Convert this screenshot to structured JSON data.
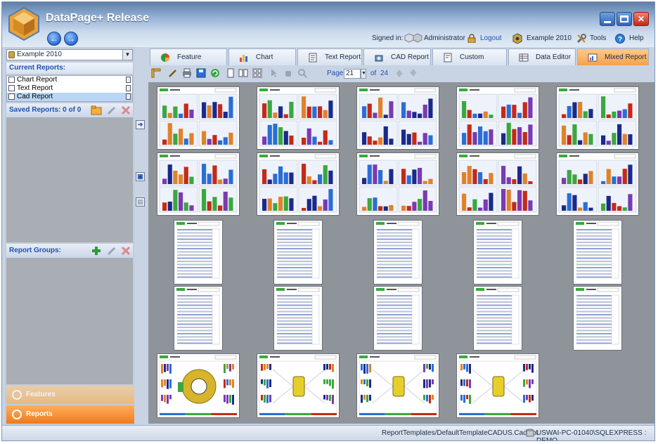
{
  "app": {
    "title": "DataPage+ Release"
  },
  "header": {
    "signed_in_label": "Signed in:",
    "user": "Administrator",
    "logout": "Logout",
    "database": "Example 2010",
    "tools": "Tools",
    "help": "Help"
  },
  "sidebar": {
    "db_select": "Example 2010",
    "current_reports_label": "Current Reports:",
    "reports": [
      "Chart Report",
      "Text Report",
      "Cad Report"
    ],
    "selected_report": "Cad Report",
    "saved_reports_label": "Saved Reports: 0 of 0",
    "report_groups_label": "Report Groups:",
    "features_label": "Features",
    "reports_label": "Reports"
  },
  "tabs": [
    {
      "label": "Feature Monitor",
      "icon": "pie-chart-icon"
    },
    {
      "label": "Chart Report",
      "icon": "bar-chart-icon"
    },
    {
      "label": "Text Report",
      "icon": "text-report-icon"
    },
    {
      "label": "CAD Report",
      "icon": "cad-icon"
    },
    {
      "label": "Custom Report",
      "icon": "custom-report-icon"
    },
    {
      "label": "Data Editor",
      "icon": "data-editor-icon"
    },
    {
      "label": "Mixed Report",
      "icon": "mixed-report-icon"
    }
  ],
  "active_tab": "Mixed Report",
  "toolbar": {
    "page_label": "Page",
    "page_value": "21",
    "of_label": "of",
    "total_pages": "24"
  },
  "thumbnails": {
    "rows": [
      {
        "type": "chart",
        "count": 5
      },
      {
        "type": "chart",
        "count": 5
      },
      {
        "type": "text",
        "count": 5
      },
      {
        "type": "text",
        "count": 5
      },
      {
        "type": "cad",
        "count": 4
      }
    ]
  },
  "status": {
    "template_path": "ReportTemplates/DefaultTemplateCADUS.CadRpt",
    "connection": "USWAI-PC-01040\\SQLEXPRESS : DEMO"
  },
  "colors": {
    "accent_orange": "#f4a24a",
    "link_blue": "#1f4fb0",
    "panel_blue": "#c8d4e4"
  }
}
